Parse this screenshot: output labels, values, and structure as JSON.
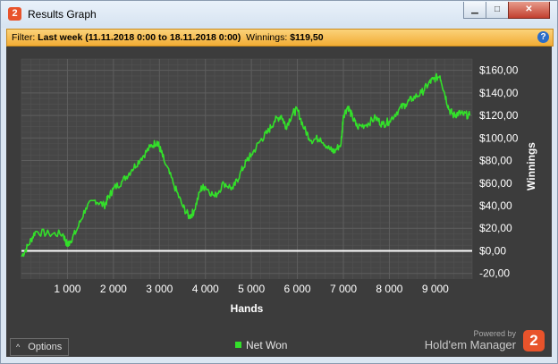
{
  "window": {
    "title": "Results Graph",
    "app_icon_glyph": "2",
    "controls": {
      "minimize": "▁",
      "maximize": "□",
      "close": "✕"
    }
  },
  "filter": {
    "filter_label": "Filter:",
    "period": "Last week (11.11.2018 0:00 to 18.11.2018 0:00)",
    "winnings_label": "Winnings:",
    "winnings_value": "$119,50",
    "help_glyph": "?"
  },
  "footer": {
    "options_caret": "^",
    "options_label": "Options",
    "powered_by": "Powered by",
    "brand": "Hold'em Manager",
    "brand_logo": "2"
  },
  "colors": {
    "series": "#33e02a",
    "zero_line": "#ffffff",
    "panel": "#3c3c3c",
    "filter_bar": "#f2ad35"
  },
  "chart_data": {
    "type": "line",
    "xlabel": "Hands",
    "ylabel": "Winnings",
    "xlim": [
      0,
      9800
    ],
    "ylim": [
      -25,
      170
    ],
    "x_ticks": [
      1000,
      2000,
      3000,
      4000,
      5000,
      6000,
      7000,
      8000,
      9000
    ],
    "x_tick_labels": [
      "1 000",
      "2 000",
      "3 000",
      "4 000",
      "5 000",
      "6 000",
      "7 000",
      "8 000",
      "9 000"
    ],
    "y_ticks": [
      -20,
      0,
      20,
      40,
      60,
      80,
      100,
      120,
      140,
      160
    ],
    "y_tick_labels": [
      "-20,00",
      "$0,00",
      "$20,00",
      "$40,00",
      "$60,00",
      "$80,00",
      "$100,00",
      "$120,00",
      "$140,00",
      "$160,00"
    ],
    "grid": true,
    "legend_position": "bottom-center",
    "series": [
      {
        "name": "Net Won",
        "x": [
          0,
          150,
          300,
          600,
          900,
          1000,
          1050,
          1200,
          1400,
          1600,
          1800,
          1900,
          2000,
          2200,
          2400,
          2600,
          2800,
          2950,
          3000,
          3100,
          3300,
          3500,
          3650,
          3750,
          3900,
          4000,
          4200,
          4400,
          4600,
          4750,
          4900,
          5000,
          5200,
          5350,
          5500,
          5650,
          5750,
          5900,
          6000,
          6150,
          6300,
          6500,
          6700,
          6800,
          6950,
          7000,
          7100,
          7200,
          7300,
          7500,
          7700,
          7850,
          8000,
          8200,
          8350,
          8500,
          8700,
          8850,
          8950,
          9100,
          9200,
          9300,
          9400,
          9500,
          9600,
          9750
        ],
        "values": [
          -5,
          5,
          17,
          15,
          15,
          5,
          8,
          18,
          38,
          45,
          40,
          48,
          55,
          62,
          72,
          82,
          92,
          97,
          92,
          80,
          60,
          40,
          30,
          35,
          55,
          57,
          48,
          60,
          55,
          68,
          80,
          85,
          98,
          105,
          115,
          120,
          110,
          122,
          125,
          108,
          98,
          100,
          90,
          88,
          95,
          120,
          128,
          118,
          110,
          112,
          118,
          112,
          115,
          125,
          130,
          135,
          140,
          148,
          152,
          155,
          140,
          125,
          120,
          122,
          121,
          120
        ]
      }
    ]
  }
}
